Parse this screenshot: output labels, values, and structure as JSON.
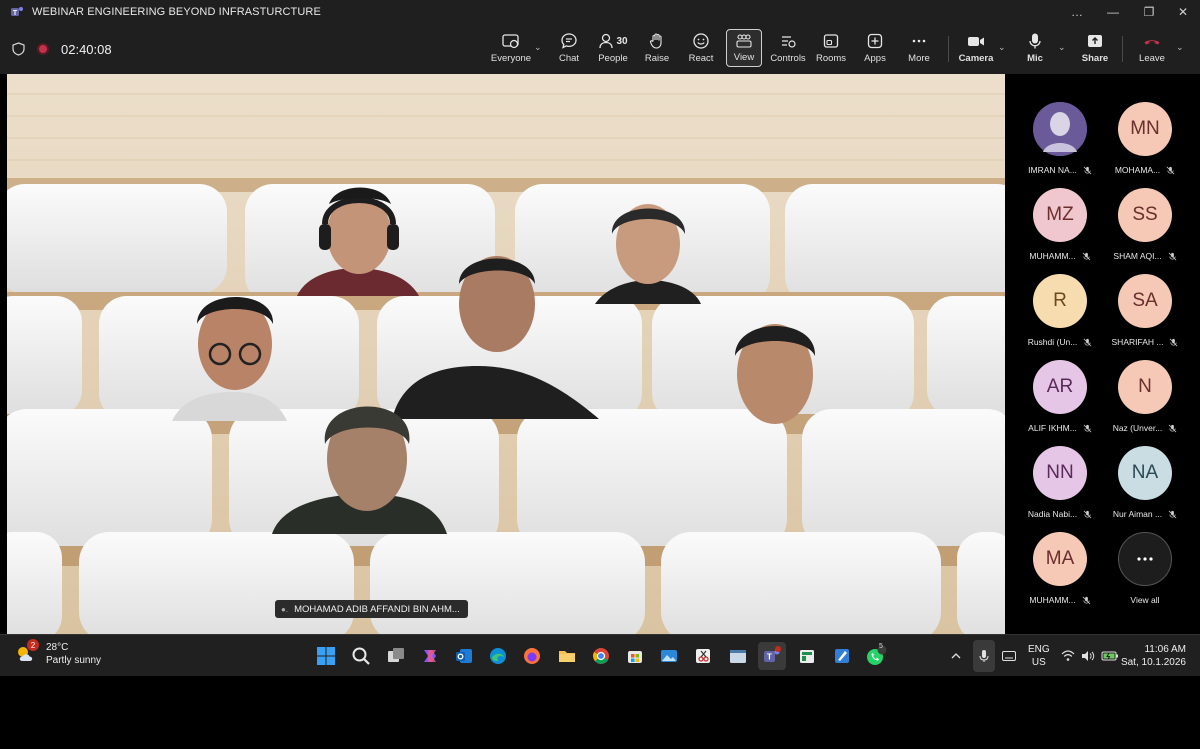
{
  "window": {
    "title": "WEBINAR ENGINEERING BEYOND INFRASTURCTURE",
    "controls": [
      "…",
      "—",
      "❐",
      "✕"
    ]
  },
  "meeting": {
    "elapsed": "02:40:08",
    "toolbar": {
      "everyone": "Everyone",
      "chat": "Chat",
      "people": "People",
      "people_count": "30",
      "raise": "Raise",
      "react": "React",
      "view": "View",
      "controls": "Controls",
      "rooms": "Rooms",
      "apps": "Apps",
      "more": "More",
      "camera": "Camera",
      "mic": "Mic",
      "share": "Share",
      "leave": "Leave"
    },
    "stage": {
      "name_tag": "MOHAMAD ADIB AFFANDI BIN AHM..."
    },
    "roster": [
      {
        "initials": "",
        "name": "IMRAN NA...",
        "muted": true,
        "bg": "#5b4a8a",
        "fg": "#ffffff",
        "photo": true
      },
      {
        "initials": "MN",
        "name": "MOHAMA...",
        "muted": true,
        "bg": "#f5c9b5",
        "fg": "#6b2e2e"
      },
      {
        "initials": "MZ",
        "name": "MUHAMM...",
        "muted": true,
        "bg": "#f0c7cf",
        "fg": "#6b2e2e"
      },
      {
        "initials": "SS",
        "name": "SHAM AQI...",
        "muted": true,
        "bg": "#f5c9b5",
        "fg": "#6b2e2e"
      },
      {
        "initials": "R",
        "name": "Rushdi (Un...",
        "muted": true,
        "bg": "#f7dcb0",
        "fg": "#6b4a1e"
      },
      {
        "initials": "SA",
        "name": "SHARIFAH ...",
        "muted": true,
        "bg": "#f5c9b5",
        "fg": "#6b2e2e"
      },
      {
        "initials": "AR",
        "name": "ALIF IKHM...",
        "muted": true,
        "bg": "#e6c6e6",
        "fg": "#5a2a5a"
      },
      {
        "initials": "N",
        "name": "Naz (Unver...",
        "muted": true,
        "bg": "#f5c9b5",
        "fg": "#6b2e2e"
      },
      {
        "initials": "NN",
        "name": "Nadia Nabi...",
        "muted": true,
        "bg": "#e6c6e6",
        "fg": "#5a2a5a"
      },
      {
        "initials": "NA",
        "name": "Nur Aiman ...",
        "muted": true,
        "bg": "#c9dde3",
        "fg": "#2a4a55"
      },
      {
        "initials": "MA",
        "name": "MUHAMM...",
        "muted": true,
        "bg": "#f5c9b5",
        "fg": "#6b2e2e"
      }
    ],
    "view_all": "View all"
  },
  "taskbar": {
    "weather_temp": "28°C",
    "weather_desc": "Partly sunny",
    "weather_badge": "2",
    "language": "ENG",
    "region": "US",
    "time": "11:06 AM",
    "date": "Sat, 10.1.2026",
    "whatsapp_badge": "5"
  },
  "colors": {
    "accent_red": "#c4314b",
    "teams_purple": "#6264a7",
    "toolbar_bg": "#1f1f1f"
  }
}
